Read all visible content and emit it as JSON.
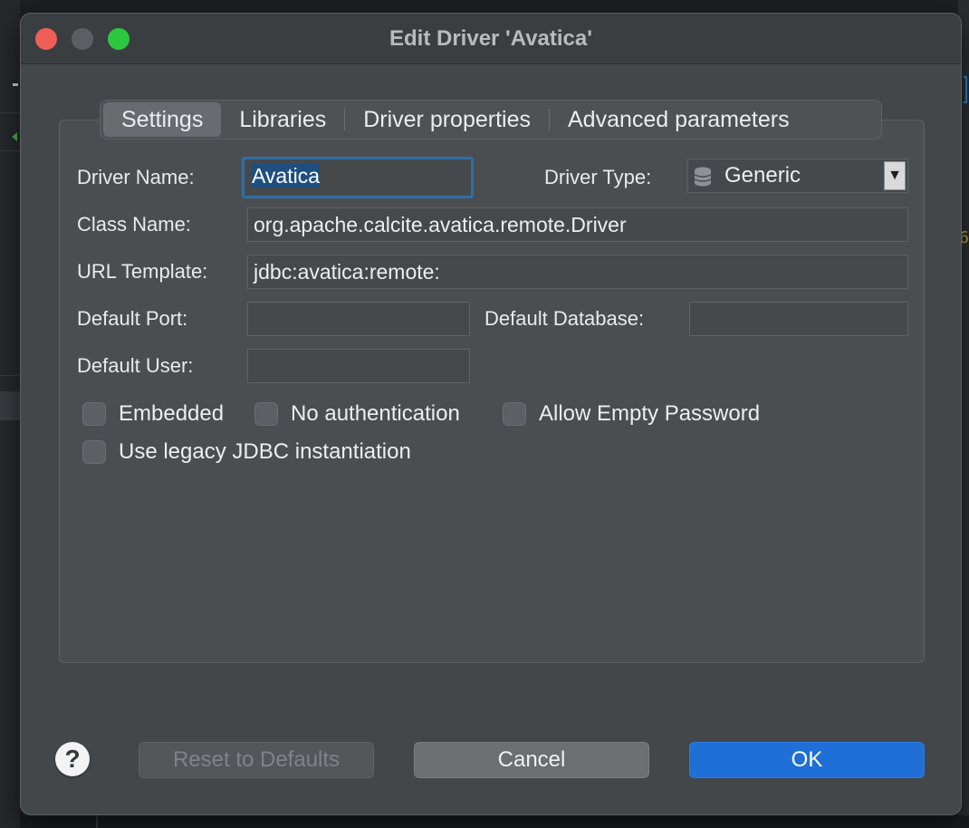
{
  "window": {
    "title": "Edit Driver 'Avatica'"
  },
  "tabs": [
    {
      "label": "Settings",
      "active": true
    },
    {
      "label": "Libraries",
      "active": false
    },
    {
      "label": "Driver properties",
      "active": false
    },
    {
      "label": "Advanced parameters",
      "active": false
    }
  ],
  "form": {
    "driver_name_label": "Driver Name:",
    "driver_name_value": "Avatica",
    "driver_type_label": "Driver Type:",
    "driver_type_value": "Generic",
    "class_name_label": "Class Name:",
    "class_name_value": "org.apache.calcite.avatica.remote.Driver",
    "url_template_label": "URL Template:",
    "url_template_value": "jdbc:avatica:remote:",
    "default_port_label": "Default Port:",
    "default_port_value": "",
    "default_database_label": "Default Database:",
    "default_database_value": "",
    "default_user_label": "Default User:",
    "default_user_value": ""
  },
  "options": {
    "embedded": {
      "label": "Embedded",
      "checked": false
    },
    "no_auth": {
      "label": "No authentication",
      "checked": false
    },
    "allow_empty_password": {
      "label": "Allow Empty Password",
      "checked": false
    },
    "legacy_jdbc": {
      "label": "Use legacy JDBC instantiation",
      "checked": false
    }
  },
  "footer": {
    "help_label": "?",
    "reset_label": "Reset to Defaults",
    "cancel_label": "Cancel",
    "ok_label": "OK"
  },
  "background": {
    "right_edge_digit": "6"
  },
  "icons": {
    "driver_type": "database-icon",
    "help": "help-icon",
    "dropdown": "dropdown-arrow-icon"
  },
  "colors": {
    "accent": "#1f6fd6",
    "focus_ring": "#2e6fa8",
    "close": "#ed5f57",
    "maximize": "#2dc640"
  }
}
